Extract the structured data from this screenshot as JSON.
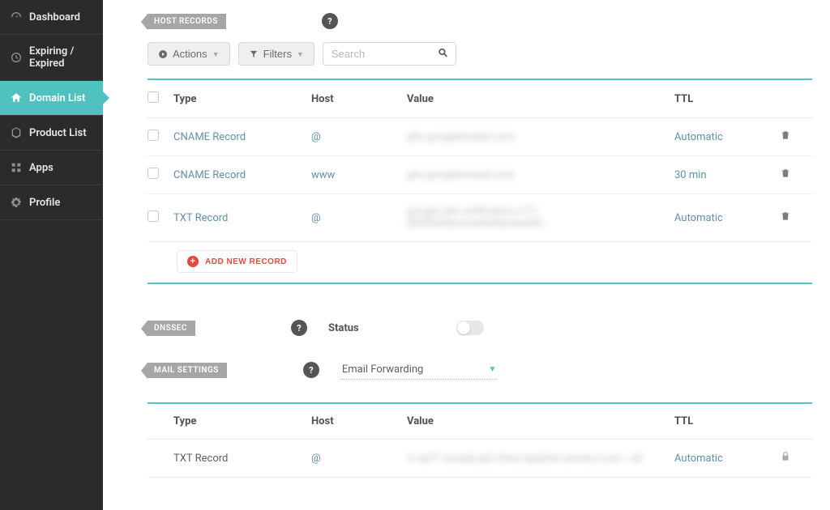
{
  "sidebar": {
    "items": [
      {
        "label": "Dashboard",
        "icon": "gauge"
      },
      {
        "label": "Expiring / Expired",
        "icon": "clock"
      },
      {
        "label": "Domain List",
        "icon": "house"
      },
      {
        "label": "Product List",
        "icon": "box"
      },
      {
        "label": "Apps",
        "icon": "grid"
      },
      {
        "label": "Profile",
        "icon": "gear"
      }
    ],
    "active_index": 2
  },
  "sections": {
    "host_records": {
      "label": "HOST RECORDS"
    },
    "dnssec": {
      "label": "DNSSEC"
    },
    "mail_settings": {
      "label": "MAIL SETTINGS"
    }
  },
  "help_glyph": "?",
  "toolbar": {
    "actions_label": "Actions",
    "filters_label": "Filters",
    "search_placeholder": "Search"
  },
  "host_table": {
    "columns": {
      "type": "Type",
      "host": "Host",
      "value": "Value",
      "ttl": "TTL"
    },
    "rows": [
      {
        "type": "CNAME Record",
        "host": "@",
        "value": "ghs.googlehosted.com",
        "ttl": "Automatic"
      },
      {
        "type": "CNAME Record",
        "host": "www",
        "value": "ghs.googlehosted.com",
        "ttl": "30 min"
      },
      {
        "type": "TXT Record",
        "host": "@",
        "value": "google-site-verification=xT1-000000Pknm3VRdNtxSwdYk...",
        "ttl": "Automatic"
      }
    ],
    "add_label": "ADD NEW RECORD"
  },
  "dnssec": {
    "status_label": "Status",
    "toggle_on": false
  },
  "mail_settings": {
    "select_value": "Email Forwarding"
  },
  "mail_table": {
    "columns": {
      "type": "Type",
      "host": "Host",
      "value": "Value",
      "ttl": "TTL"
    },
    "rows": [
      {
        "type": "TXT Record",
        "host": "@",
        "value": "v=spf1 include:spf.efwd.registrar-servers.com ~all",
        "ttl": "Automatic"
      }
    ]
  }
}
